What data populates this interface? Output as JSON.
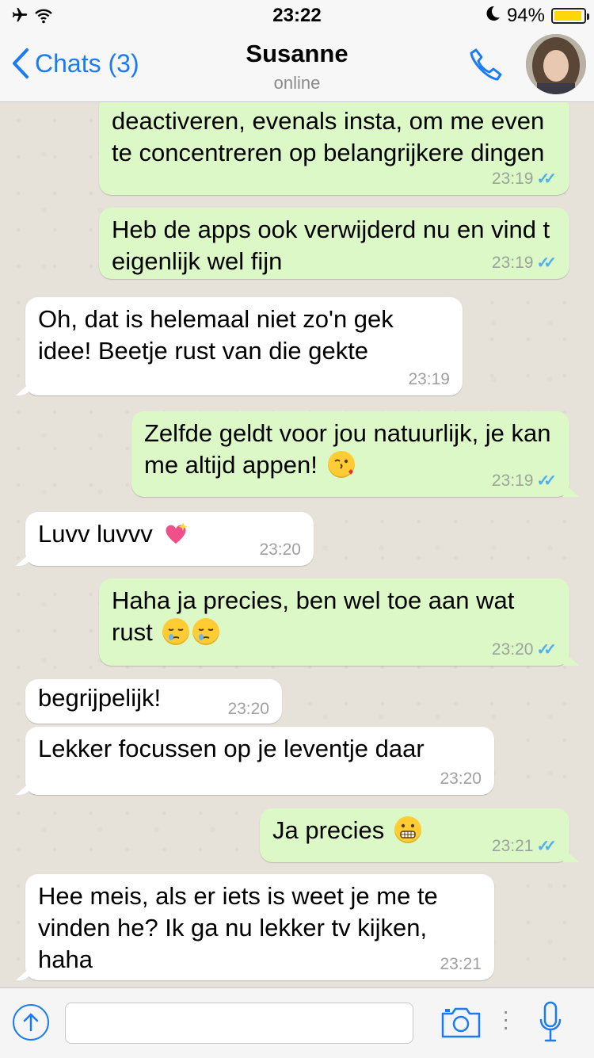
{
  "status_bar": {
    "time": "23:22",
    "battery": "94%",
    "battery_level": 0.94,
    "icons": [
      "airplane-icon",
      "wifi-icon",
      "moon-icon",
      "battery-icon"
    ]
  },
  "nav": {
    "back_label": "Chats (3)",
    "contact_name": "Susanne",
    "status": "online"
  },
  "messages": [
    {
      "dir": "out",
      "text": "deactiveren, evenals insta, om me even te concentreren op belangrijkere dingen",
      "time": "23:19",
      "read": true
    },
    {
      "dir": "out",
      "text": "Heb de apps ook verwijderd nu en vind t eigenlijk wel fijn",
      "time": "23:19",
      "read": true
    },
    {
      "dir": "in",
      "text": "Oh, dat is helemaal niet zo'n gek idee! Beetje rust van die gekte",
      "time": "23:19"
    },
    {
      "dir": "out",
      "text": "Zelfde geldt voor jou natuurlijk, je kan me altijd appen!",
      "emoji": [
        "kissing-face"
      ],
      "time": "23:19",
      "read": true
    },
    {
      "dir": "in",
      "text": "Luvv luvvv",
      "emoji": [
        "sparkling-heart"
      ],
      "time": "23:20"
    },
    {
      "dir": "out",
      "text": "Haha ja precies, ben wel toe aan wat rust",
      "emoji": [
        "sleepy-face",
        "sleepy-face"
      ],
      "time": "23:20",
      "read": true
    },
    {
      "dir": "in",
      "text": "begrijpelijk!",
      "time": "23:20"
    },
    {
      "dir": "in",
      "text": "Lekker focussen op je leventje daar",
      "time": "23:20"
    },
    {
      "dir": "out",
      "text": "Ja precies",
      "emoji": [
        "grimacing-face"
      ],
      "time": "23:21",
      "read": true
    },
    {
      "dir": "in",
      "text": "Hee meis, als er iets is weet je me te vinden he? Ik ga nu lekker tv kijken, haha",
      "time": "23:21"
    }
  ],
  "input": {
    "placeholder": "",
    "value": ""
  }
}
